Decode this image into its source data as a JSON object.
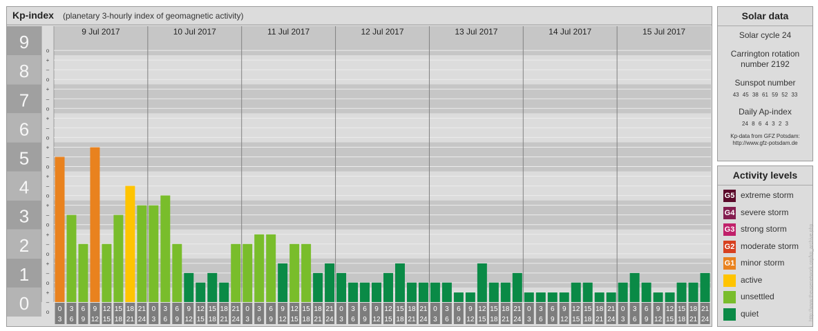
{
  "header": {
    "title": "Kp-index",
    "subtitle": "(planetary 3-hourly index of geomagnetic activity)"
  },
  "y_labels": [
    "9",
    "8",
    "7",
    "6",
    "5",
    "4",
    "3",
    "2",
    "1",
    "0"
  ],
  "subdivisions": [
    "o",
    "–",
    "+"
  ],
  "time_ranges": [
    {
      "start": "0",
      "end": "3"
    },
    {
      "start": "3",
      "end": "6"
    },
    {
      "start": "6",
      "end": "9"
    },
    {
      "start": "9",
      "end": "12"
    },
    {
      "start": "12",
      "end": "15"
    },
    {
      "start": "15",
      "end": "18"
    },
    {
      "start": "18",
      "end": "21"
    },
    {
      "start": "21",
      "end": "24"
    }
  ],
  "chart_data": {
    "type": "bar",
    "title": "Kp-index",
    "subtitle": "(planetary 3-hourly index of geomagnetic activity)",
    "ylim": [
      0,
      9
    ],
    "days": [
      "9 Jul 2017",
      "10 Jul 2017",
      "11 Jul 2017",
      "12 Jul 2017",
      "13 Jul 2017",
      "14 Jul 2017",
      "15 Jul 2017"
    ],
    "values": [
      [
        5,
        3,
        2,
        5.33,
        2,
        3,
        4,
        3.33
      ],
      [
        3.33,
        3.67,
        2,
        1,
        0.67,
        1,
        0.67,
        2
      ],
      [
        2,
        2.33,
        2.33,
        1.33,
        2,
        2,
        1,
        1.33
      ],
      [
        1,
        0.67,
        0.67,
        0.67,
        1,
        1.33,
        0.67,
        0.67
      ],
      [
        0.67,
        0.67,
        0.33,
        0.33,
        1.33,
        0.67,
        0.67,
        1
      ],
      [
        0.33,
        0.33,
        0.33,
        0.33,
        0.67,
        0.67,
        0.33,
        0.33
      ],
      [
        0.67,
        1,
        0.67,
        0.33,
        0.33,
        0.67,
        0.67,
        1
      ]
    ],
    "grid": true,
    "colors": {
      "quiet": "#0a8a46",
      "unsettled": "#79bd2b",
      "active": "#ffc400",
      "G1": "#e9821e",
      "G2": "#d7401f",
      "G3": "#c0206a",
      "G4": "#841d4f",
      "G5": "#5a0a2a"
    }
  },
  "solar": {
    "title": "Solar data",
    "cycle": "Solar cycle 24",
    "carrington_line1": "Carrington rotation",
    "carrington_line2": "number 2192",
    "sunspot_title": "Sunspot number",
    "sunspot_values": "43 45 38 61 59 52 33",
    "ap_title": "Daily Ap-index",
    "ap_values": "24 8 6 4 3 2 3",
    "source_line1": "Kp-data from GFZ Potsdam:",
    "source_line2": "http://www.gfz-potsdam.de"
  },
  "activity": {
    "title": "Activity levels",
    "levels": [
      {
        "code": "G5",
        "label": "extreme storm",
        "color": "#5a0a2a"
      },
      {
        "code": "G4",
        "label": "severe storm",
        "color": "#841d4f"
      },
      {
        "code": "G3",
        "label": "strong storm",
        "color": "#c0206a"
      },
      {
        "code": "G2",
        "label": "moderate storm",
        "color": "#d7401f"
      },
      {
        "code": "G1",
        "label": "minor storm",
        "color": "#e9821e"
      },
      {
        "code": "",
        "label": "active",
        "color": "#ffc400"
      },
      {
        "code": "",
        "label": "unsettled",
        "color": "#79bd2b"
      },
      {
        "code": "",
        "label": "quiet",
        "color": "#0a8a46"
      }
    ]
  },
  "watermark": "http://www.theusenetwork.org/kp_archive.php"
}
